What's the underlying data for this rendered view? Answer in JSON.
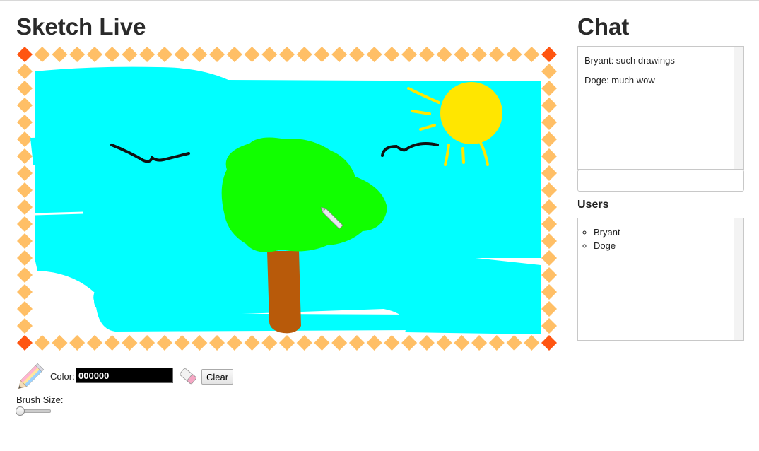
{
  "app": {
    "title": "Sketch Live"
  },
  "toolbar": {
    "color_label": "Color:",
    "color_value": "000000",
    "clear_label": "Clear",
    "brush_label": "Brush Size:",
    "brush_size_fraction": 0.0
  },
  "chat": {
    "title": "Chat",
    "messages": [
      {
        "text": "Bryant: such drawings"
      },
      {
        "text": "Doge: much wow"
      }
    ],
    "input_value": ""
  },
  "users": {
    "title": "Users",
    "list": [
      "Bryant",
      "Doge"
    ]
  },
  "colors": {
    "frame_diamond": "#ffbf66",
    "frame_corner": "#ff5511",
    "sky": "#00ffff",
    "tree_foliage": "#11ff00",
    "tree_trunk": "#b85a0a",
    "sun": "#ffe600",
    "strokes": "#111111"
  },
  "icons": {
    "pencil": "pencil-icon",
    "eraser": "eraser-icon"
  }
}
